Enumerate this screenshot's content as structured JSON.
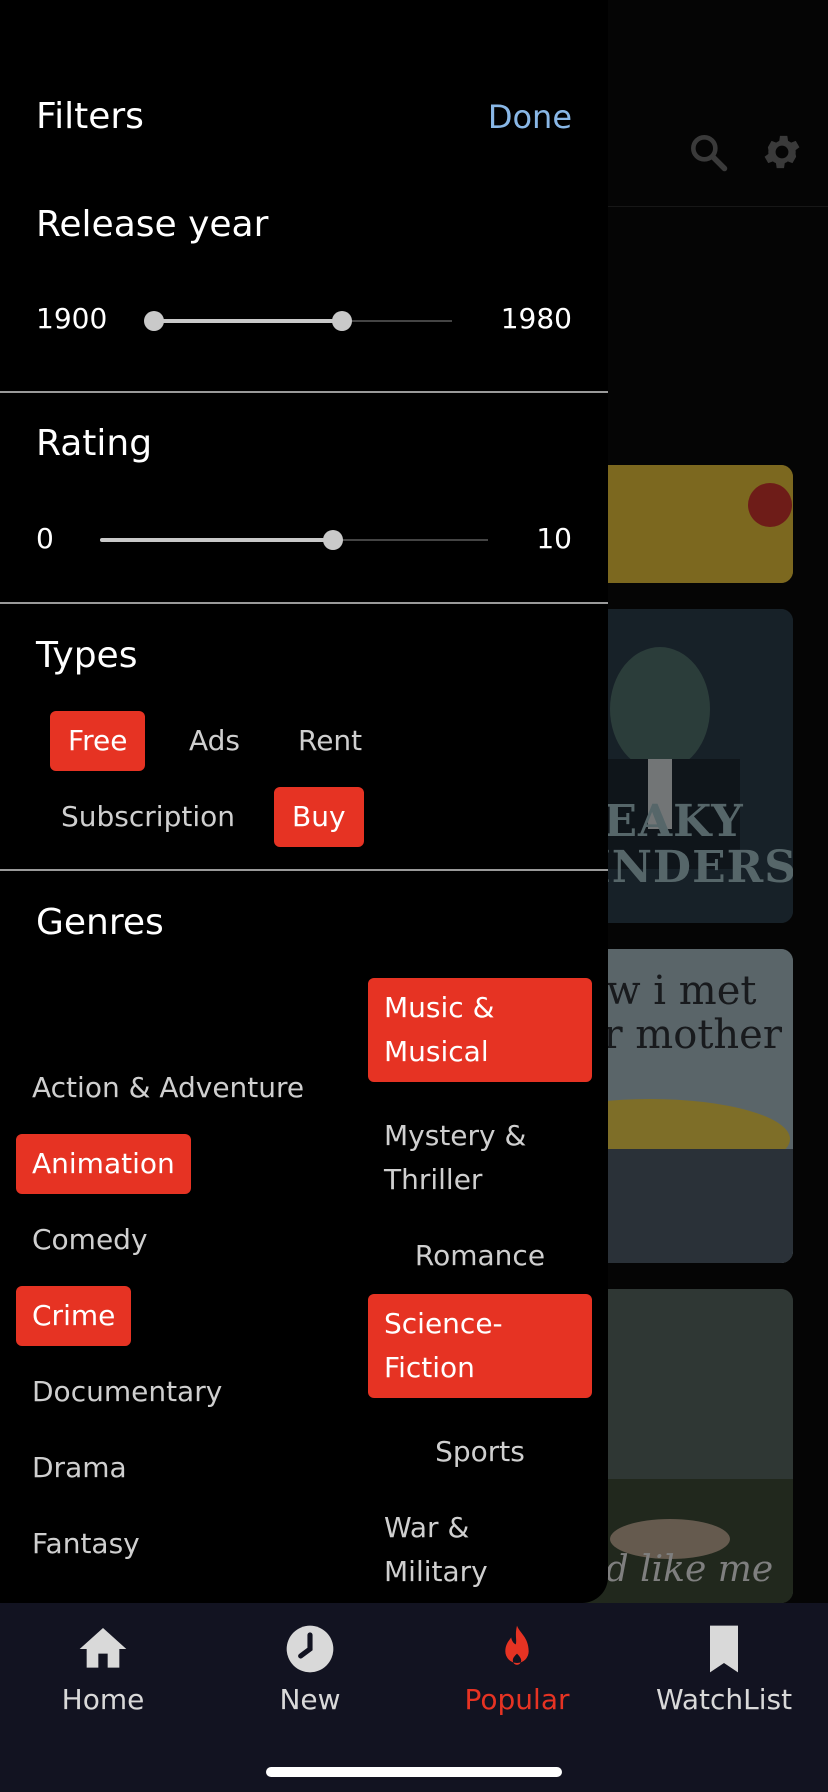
{
  "drawer": {
    "title": "Filters",
    "done_label": "Done",
    "release_year": {
      "title": "Release year",
      "min_label": "1900",
      "max_label": "1980",
      "range_low": 0.0,
      "range_high": 0.63
    },
    "rating": {
      "title": "Rating",
      "min_label": "0",
      "max_label": "10",
      "value": 0.6
    },
    "types": {
      "title": "Types",
      "items": [
        {
          "label": "Free",
          "selected": true
        },
        {
          "label": "Ads",
          "selected": false
        },
        {
          "label": "Rent",
          "selected": false
        },
        {
          "label": "Subscription",
          "selected": false
        },
        {
          "label": "Buy",
          "selected": true
        }
      ]
    },
    "genres": {
      "title": "Genres",
      "left": [
        {
          "label": "Action & Adventure",
          "selected": false
        },
        {
          "label": "Animation",
          "selected": true
        },
        {
          "label": "Comedy",
          "selected": false
        },
        {
          "label": "Crime",
          "selected": true
        },
        {
          "label": "Documentary",
          "selected": false
        },
        {
          "label": "Drama",
          "selected": false
        },
        {
          "label": "Fantasy",
          "selected": false
        }
      ],
      "right": [
        {
          "label": "Music & Musical",
          "selected": true
        },
        {
          "label": "Mystery & Thriller",
          "selected": false
        },
        {
          "label": "Romance",
          "selected": false
        },
        {
          "label": "Science-Fiction",
          "selected": true
        },
        {
          "label": "Sports",
          "selected": false
        },
        {
          "label": "War & Military",
          "selected": false
        }
      ]
    }
  },
  "background": {
    "posters": [
      "PEAKY BLINDERS",
      "how i met your mother",
      "dead like me"
    ]
  },
  "tabbar": {
    "tabs": [
      {
        "label": "Home",
        "icon": "home-icon",
        "active": false
      },
      {
        "label": "New",
        "icon": "clock-icon",
        "active": false
      },
      {
        "label": "Popular",
        "icon": "flame-icon",
        "active": true
      },
      {
        "label": "WatchList",
        "icon": "bookmark-icon",
        "active": false
      }
    ]
  },
  "colors": {
    "accent": "#e63323",
    "done": "#89b7e6",
    "tabbar_bg": "#121321"
  }
}
